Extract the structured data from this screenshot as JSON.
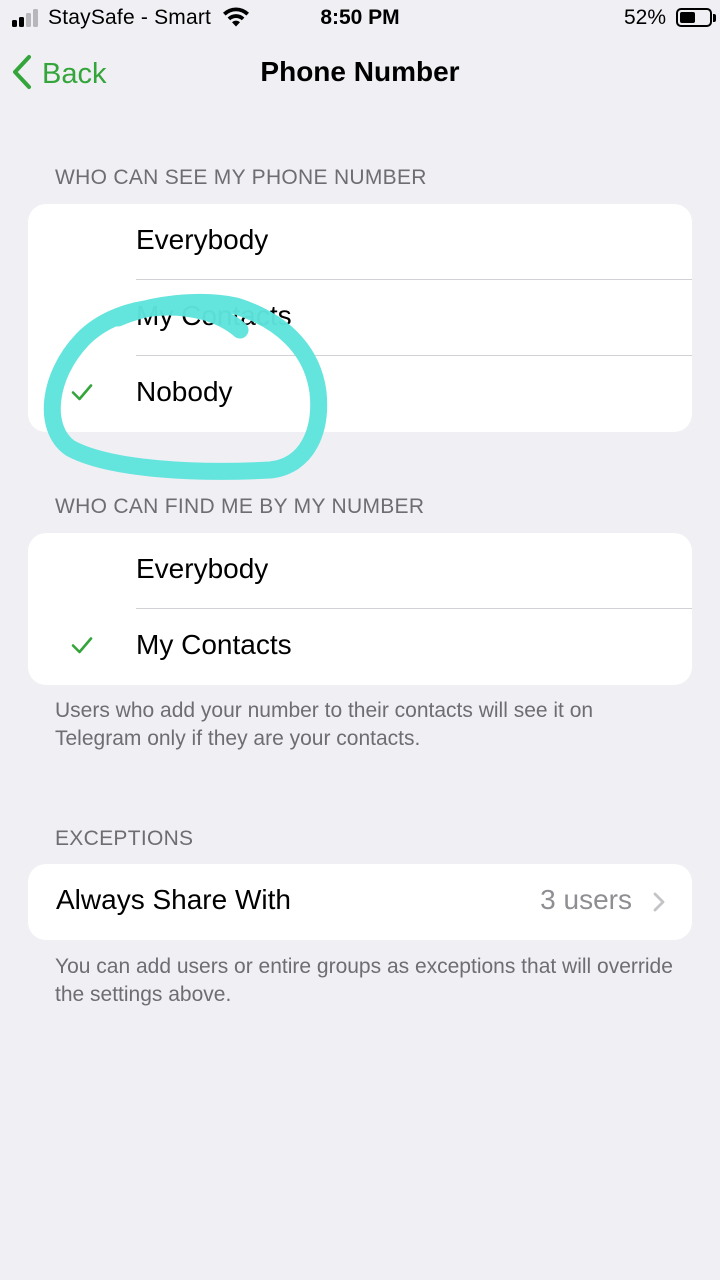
{
  "status_bar": {
    "carrier": "StaySafe - Smart",
    "time": "8:50 PM",
    "battery_percent": "52%",
    "battery_level": 0.52,
    "signal_bars": 2,
    "icons": [
      "signal-icon",
      "wifi-icon",
      "battery-icon"
    ]
  },
  "nav": {
    "back_label": "Back",
    "title": "Phone Number",
    "accent_color": "#34a53a"
  },
  "see_section": {
    "header": "WHO CAN SEE MY PHONE NUMBER",
    "options": [
      {
        "label": "Everybody",
        "selected": false
      },
      {
        "label": "My Contacts",
        "selected": false
      },
      {
        "label": "Nobody",
        "selected": true
      }
    ]
  },
  "find_section": {
    "header": "WHO CAN FIND ME BY MY NUMBER",
    "options": [
      {
        "label": "Everybody",
        "selected": false
      },
      {
        "label": "My Contacts",
        "selected": true
      }
    ],
    "footer": "Users who add your number to their contacts will see it on Telegram only if they are your contacts."
  },
  "exceptions": {
    "header": "EXCEPTIONS",
    "always_share_label": "Always Share With",
    "always_share_value": "3 users",
    "footer": "You can add users or entire groups as exceptions that will override the settings above."
  },
  "annotation": {
    "type": "hand-drawn circle",
    "color": "#5ee3dc"
  }
}
